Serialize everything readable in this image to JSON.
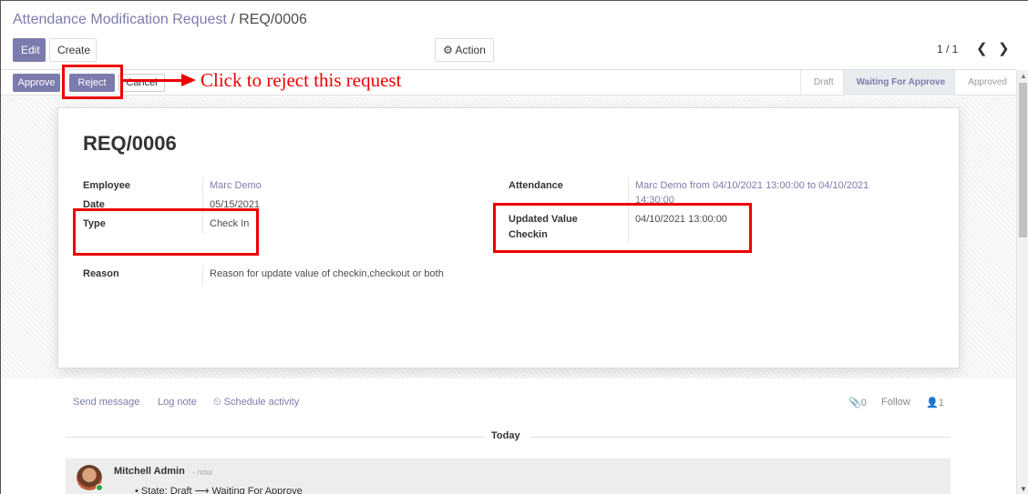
{
  "breadcrumb": {
    "parent": "Attendance Modification Request",
    "separator": "/",
    "current": "REQ/0006"
  },
  "toolbar": {
    "edit": "Edit",
    "create": "Create",
    "action": "Action"
  },
  "pager": {
    "value": "1 / 1",
    "prev": "❮",
    "next": "❯"
  },
  "statusbar": {
    "buttons": {
      "approve": "Approve",
      "reject": "Reject",
      "cancel": "Cancel"
    },
    "stages": [
      "Draft",
      "Waiting For Approve",
      "Approved"
    ],
    "active_stage": "Waiting For Approve"
  },
  "record": {
    "name": "REQ/0006",
    "employee_label": "Employee",
    "employee_value": "Marc Demo",
    "date_label": "Date",
    "date_value": "05/15/2021",
    "type_label": "Type",
    "type_value": "Check In",
    "reason_label": "Reason",
    "reason_value": "Reason for update value of checkin,checkout or both",
    "attendance_label": "Attendance",
    "attendance_value_line1": "Marc Demo from 04/10/2021 13:00:00 to 04/10/2021",
    "attendance_value_line2": "14:30:00",
    "updated_label_line1": "Updated Value",
    "updated_label_line2": "Checkin",
    "updated_value": "04/10/2021 13:00:00"
  },
  "chatter": {
    "send_message": "Send message",
    "log_note": "Log note",
    "schedule_activity": "Schedule activity",
    "attachments_count": "0",
    "follow": "Follow",
    "followers_count": "1",
    "day_separator": "Today",
    "message": {
      "author": "Mitchell Admin",
      "when": "- now",
      "tracking": "State: Draft ⟶ Waiting For Approve"
    }
  },
  "annotation": {
    "text": "Click to reject this request"
  },
  "colors": {
    "brand": "#7c7bad",
    "annotation": "#e00000"
  }
}
